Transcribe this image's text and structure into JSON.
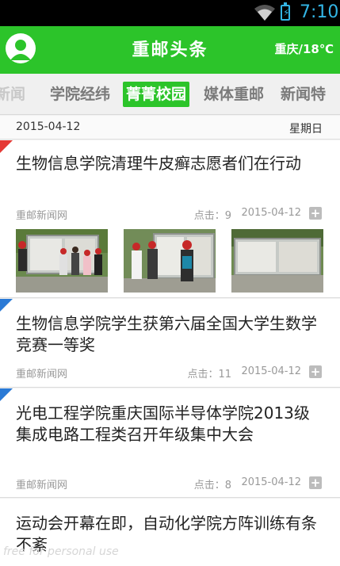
{
  "status": {
    "time": "7:10"
  },
  "header": {
    "title": "重邮头条",
    "weather": "重庆/18℃"
  },
  "tabs": [
    {
      "label": "新闻"
    },
    {
      "label": "学院经纬"
    },
    {
      "label": "菁菁校园"
    },
    {
      "label": "媒体重邮"
    },
    {
      "label": "新闻特"
    }
  ],
  "active_tab": 2,
  "date_bar": {
    "date": "2015-04-12",
    "weekday": "星期日"
  },
  "articles": [
    {
      "title": "生物信息学院清理牛皮癣志愿者们在行动",
      "source": "重邮新闻网",
      "clicks": "点击：9",
      "date": "2015-04-12",
      "badge_color": "#e53935"
    },
    {
      "title": "生物信息学院学生获第六届全国大学生数学竞赛一等奖",
      "source": "重邮新闻网",
      "clicks": "点击：11",
      "date": "2015-04-12",
      "badge_color": "#2a7ad6"
    },
    {
      "title": "光电工程学院重庆国际半导体学院2013级集成电路工程类召开年级集中大会",
      "source": "重邮新闻网",
      "clicks": "点击：8",
      "date": "2015-04-12",
      "badge_color": "#2a7ad6"
    },
    {
      "title": "运动会开幕在即，自动化学院方阵训练有条不紊"
    }
  ],
  "watermark": "free for personal use"
}
